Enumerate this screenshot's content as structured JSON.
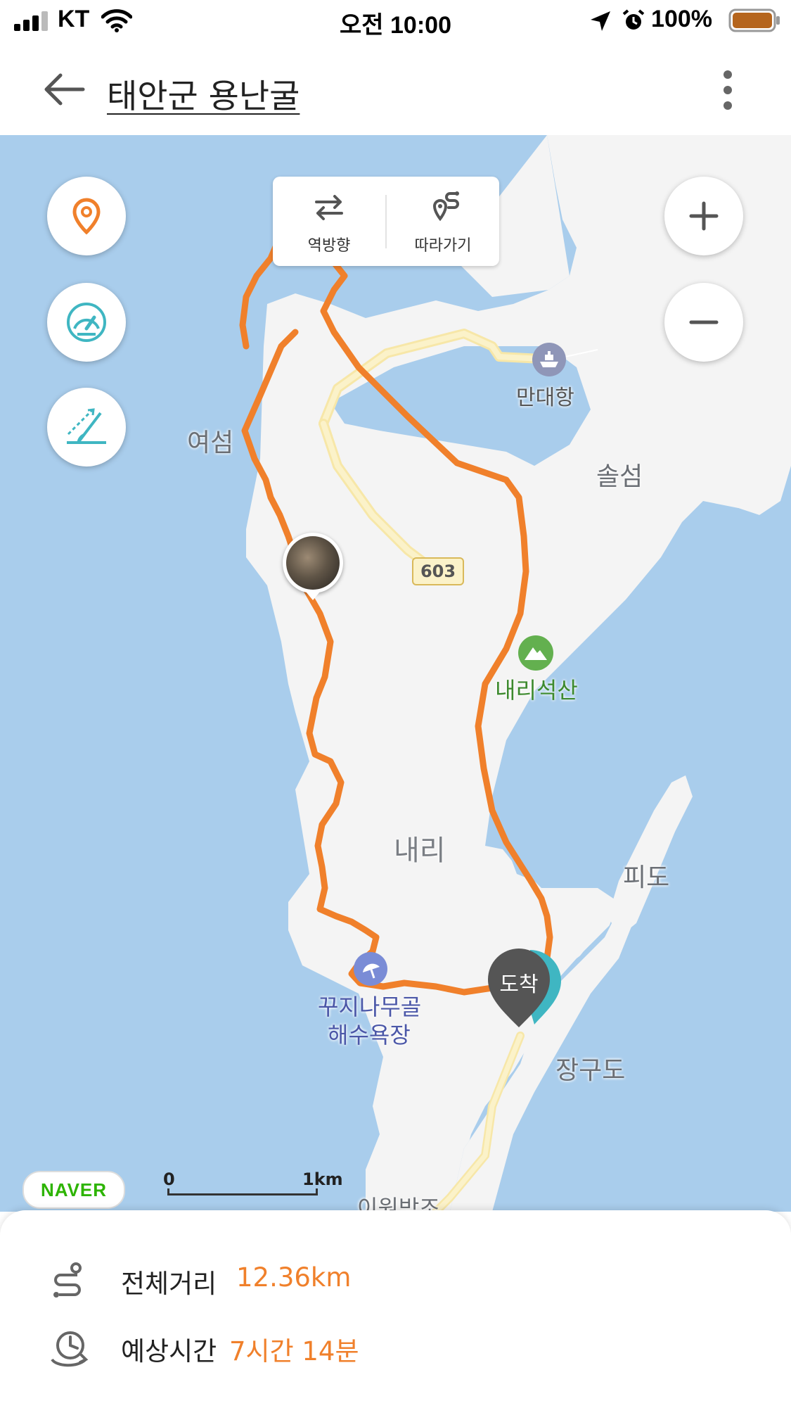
{
  "status_bar": {
    "carrier": "KT",
    "time": "오전 10:00",
    "battery": "100%"
  },
  "header": {
    "title": "태안군 용난굴"
  },
  "map": {
    "controls": {
      "reverse_label": "역방향",
      "follow_label": "따라가기"
    },
    "places": {
      "yeoseom": "여섬",
      "mandae_port": "만대항",
      "solseom": "솔섬",
      "naeri_seoksan": "내리석산",
      "naeri": "내리",
      "pido": "피도",
      "ggujinamugol_1": "꾸지나무골",
      "ggujinamugol_2": "해수욕장",
      "janggudo": "장구도",
      "iwonbangjo": "이원방조"
    },
    "road_number": "603",
    "arrival_marker": "도착",
    "scale": {
      "start": "0",
      "end": "1km"
    },
    "naver_logo": "NAVER"
  },
  "summary": {
    "distance_label": "전체거리",
    "distance_value": "12.36km",
    "time_label": "예상시간",
    "time_value": "7시간 14분"
  },
  "colors": {
    "route": "#f0802b",
    "water": "#a9cdec",
    "land": "#f4f4f4",
    "accent_teal": "#3fb6c2",
    "highlight_orange": "#f0802b"
  }
}
